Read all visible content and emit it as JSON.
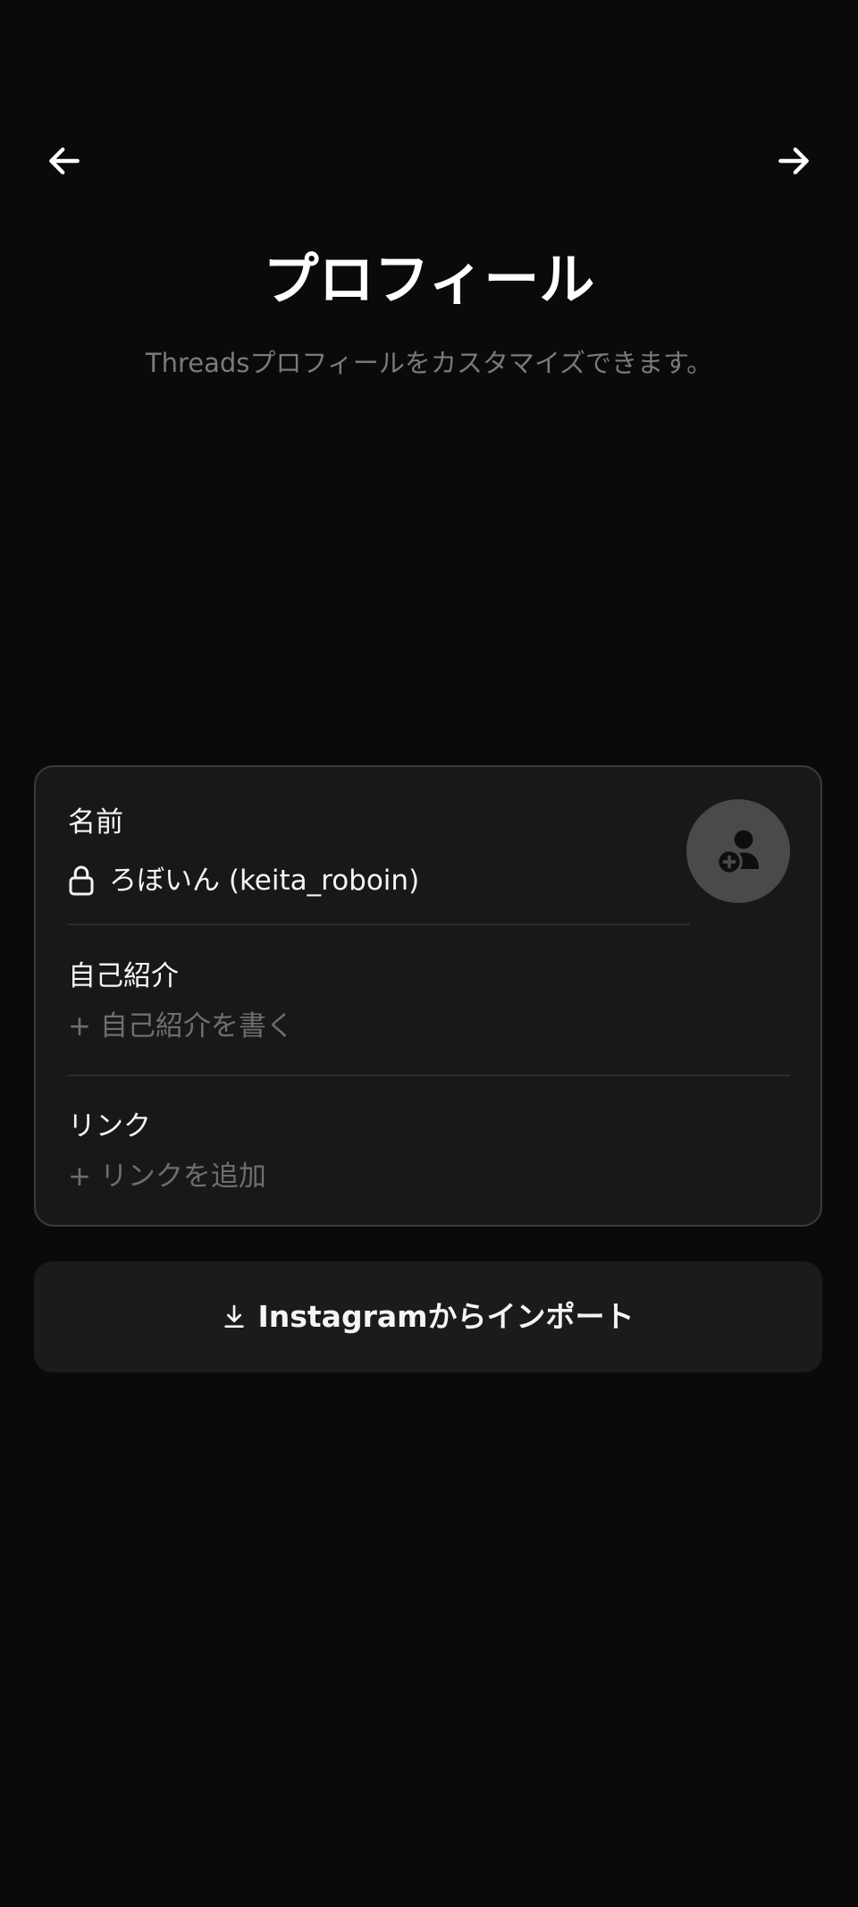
{
  "header": {
    "back_icon": "arrow-left-icon",
    "next_icon": "arrow-right-icon",
    "title": "プロフィール",
    "subtitle": "Threadsプロフィールをカスタマイズできます。"
  },
  "profile_card": {
    "name": {
      "label": "名前",
      "value": "ろぼいん (keita_roboin)",
      "icon": "lock-icon"
    },
    "avatar": {
      "icon": "add-person-icon"
    },
    "bio": {
      "label": "自己紹介",
      "placeholder": "+ 自己紹介を書く"
    },
    "link": {
      "label": "リンク",
      "placeholder": "+ リンクを追加"
    }
  },
  "import_button": {
    "icon": "download-icon",
    "label": "Instagramからインポート"
  },
  "colors": {
    "background": "#0a0a0a",
    "card": "#181818",
    "card_border": "#3b3b3b",
    "avatar_bg": "#4a4a4a",
    "muted_text": "#6e6e6e"
  }
}
